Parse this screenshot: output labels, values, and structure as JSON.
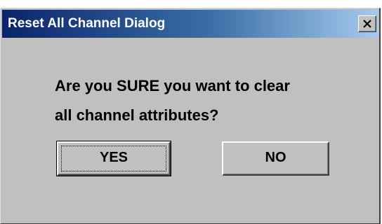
{
  "window": {
    "title": "Reset All Channel Dialog",
    "close_icon": "close-icon",
    "titlebar_color": "#0a246a",
    "face_color": "#c0c0c0"
  },
  "message": {
    "line1": "Are you SURE you want to clear",
    "line2": "all channel attributes?"
  },
  "buttons": {
    "yes_label": "YES",
    "no_label": "NO"
  }
}
